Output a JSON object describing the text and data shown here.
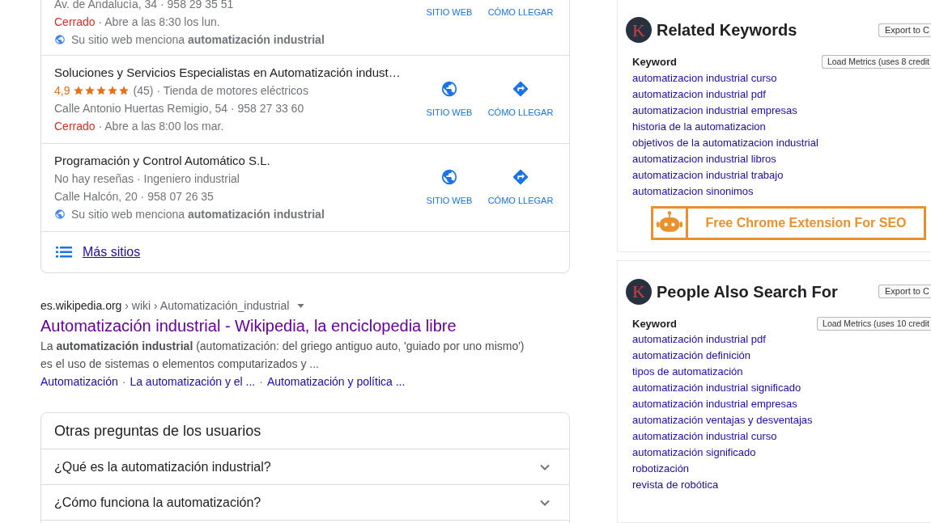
{
  "local_results": {
    "listings": [
      {
        "kind": "cut",
        "address": "Av. de Andalucía, 34 · 958 29 35 51",
        "status": "Cerrado",
        "hours": "· Abre a las 8:30 los lun.",
        "mention": "Su sitio web menciona **automatización industrial**",
        "actions": [
          "SITIO WEB",
          "CÓMO LLEGAR"
        ]
      },
      {
        "kind": "full",
        "name": "Soluciones y Servicios Especialistas en Automatización indust…",
        "rating": "4,9",
        "stars": 5,
        "reviews": "(45)",
        "category": "· Tienda de motores eléctricos",
        "address": "Calle Antonio Huertas Remigio, 54 · 958 27 33 60",
        "status": "Cerrado",
        "hours": "· Abre a las 8:00 los mar.",
        "actions": [
          "SITIO WEB",
          "CÓMO LLEGAR"
        ]
      },
      {
        "kind": "full",
        "name": "Programación y Control Automático S.L.",
        "reviews": "No hay reseñas",
        "category": "· Ingeniero industrial",
        "address": "Calle Halcón, 20 · 958 07 26 35",
        "mention": "Su sitio web menciona **automatización industrial**",
        "actions": [
          "SITIO WEB",
          "CÓMO LLEGAR"
        ]
      }
    ],
    "more_link": "Más sitios"
  },
  "web_result": {
    "domain": "es.wikipedia.org",
    "path": "› wiki › Automatización_industrial",
    "title": "Automatización industrial - Wikipedia, la enciclopedia libre",
    "snippet": [
      "La **automatización industrial** (automatización: del griego antiguo auto, 'guiado por uno mismo')",
      "es el uso de sistemas o elementos computarizados y ..."
    ],
    "sitelinks": [
      "Automatización",
      "La automatización y el ...",
      "Automatización y política ..."
    ],
    "separator": "·"
  },
  "related_questions": {
    "title": "Otras preguntas de los usuarios",
    "questions": [
      {
        "text": "¿Qué es la automatización industrial?",
        "expanded": false
      },
      {
        "text": "¿Cómo funciona la automatización?",
        "expanded": false
      }
    ]
  },
  "panels": [
    {
      "logo_letter": "K",
      "title": "Related Keywords",
      "export_label": "Export to C",
      "column_heading": "Keyword",
      "load_label": "Load Metrics (uses 8 credit",
      "keywords": [
        "automatizacion industrial curso",
        "automatizacion industrial pdf",
        "automatizacion industrial empresas",
        "historia de la automatizacion",
        "objetivos de la automatizacion industrial",
        "automatizacion industrial libros",
        "automatizacion industrial trabajo",
        "automatizacion sinonimos"
      ],
      "promo": "Free Chrome Extension For SEO"
    },
    {
      "logo_letter": "K",
      "title": "People Also Search For",
      "export_label": "Export to C",
      "column_heading": "Keyword",
      "load_label": "Load Metrics (uses 10 credit",
      "keywords": [
        "automatización industrial pdf",
        "automatización definición",
        "tipos de automatización",
        "automatización industrial significado",
        "automatización industrial empresas",
        "automatización ventajas y desventajas",
        "automatización industrial curso",
        "automatización significado",
        "robotización",
        "revista de robótica"
      ]
    }
  ]
}
